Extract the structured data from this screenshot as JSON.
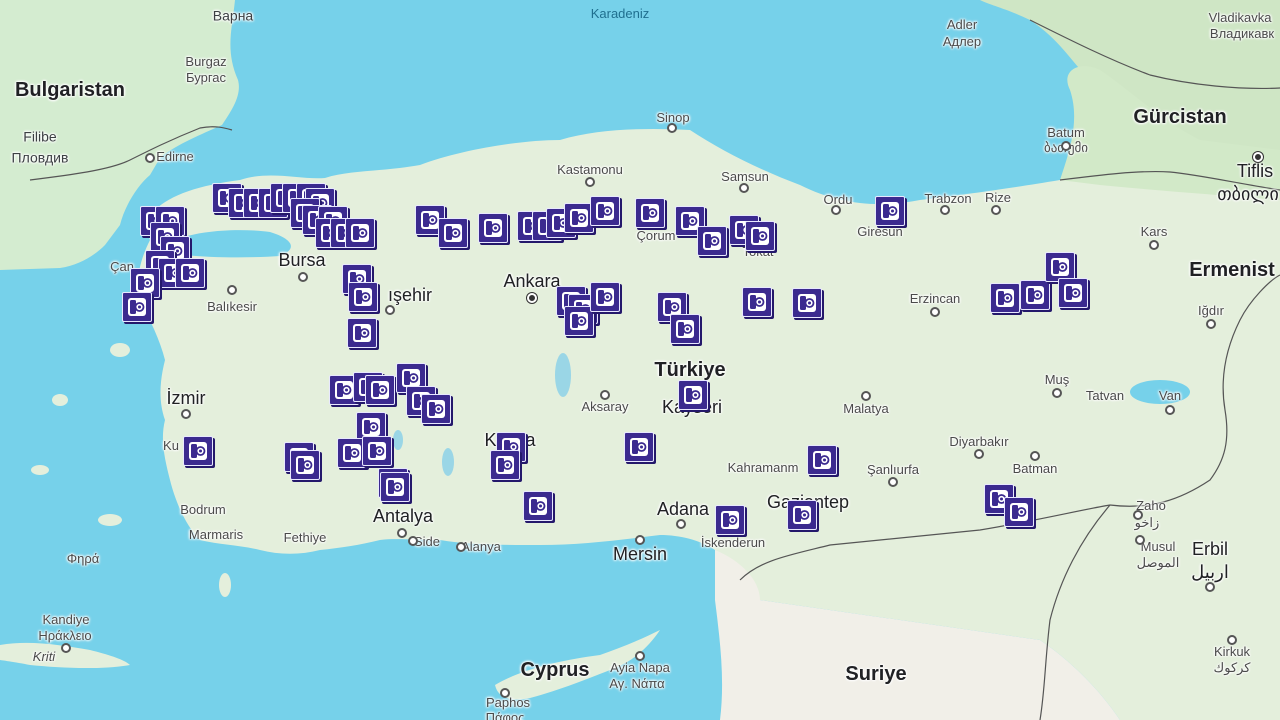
{
  "map": {
    "marker_icon": "speed-camera-icon",
    "marker_color": "#3b2a8f",
    "labels": [
      {
        "key": "karadeniz",
        "text": "Karadeniz",
        "cls": "sea"
      },
      {
        "key": "varna",
        "text": "Варна",
        "cls": "city"
      },
      {
        "key": "burgaz",
        "text": "Burgaz",
        "cls": "small"
      },
      {
        "key": "burgas_cyr",
        "text": "Бургас",
        "cls": "small"
      },
      {
        "key": "bulgaristan",
        "text": "Bulgaristan",
        "cls": "country"
      },
      {
        "key": "filibe",
        "text": "Filibe",
        "cls": "city"
      },
      {
        "key": "plovdiv",
        "text": "Пловдив",
        "cls": "city"
      },
      {
        "key": "edirne",
        "text": "Edirne",
        "cls": "small"
      },
      {
        "key": "canakkale",
        "text": "Çan",
        "cls": "small"
      },
      {
        "key": "bursa",
        "text": "Bursa",
        "cls": "city-big"
      },
      {
        "key": "balikesir",
        "text": "Balıkesir",
        "cls": "small"
      },
      {
        "key": "eskisehir",
        "text": "ışehir",
        "cls": "city-big"
      },
      {
        "key": "izmir",
        "text": "İzmir",
        "cls": "city-big"
      },
      {
        "key": "kusadasi",
        "text": "Ku",
        "cls": "small"
      },
      {
        "key": "bodrum",
        "text": "Bodrum",
        "cls": "small"
      },
      {
        "key": "marmaris",
        "text": "Marmaris",
        "cls": "small"
      },
      {
        "key": "fethiye",
        "text": "Fethiye",
        "cls": "small"
      },
      {
        "key": "antalya",
        "text": "Antalya",
        "cls": "city-big"
      },
      {
        "key": "side",
        "text": "Side",
        "cls": "small"
      },
      {
        "key": "alanya",
        "text": "Alanya",
        "cls": "small"
      },
      {
        "key": "kastamonu",
        "text": "Kastamonu",
        "cls": "small"
      },
      {
        "key": "sinop",
        "text": "Sinop",
        "cls": "small"
      },
      {
        "key": "samsun",
        "text": "Samsun",
        "cls": "small"
      },
      {
        "key": "ordu",
        "text": "Ordu",
        "cls": "small"
      },
      {
        "key": "giresun",
        "text": "Giresun",
        "cls": "small"
      },
      {
        "key": "trabzon",
        "text": "Trabzon",
        "cls": "small"
      },
      {
        "key": "rize",
        "text": "Rize",
        "cls": "small"
      },
      {
        "key": "ankara",
        "text": "Ankara",
        "cls": "city-big"
      },
      {
        "key": "corum",
        "text": "Çorum",
        "cls": "small"
      },
      {
        "key": "tokat",
        "text": "Tokat",
        "cls": "small"
      },
      {
        "key": "turkiye",
        "text": "Türkiye",
        "cls": "country"
      },
      {
        "key": "aksaray",
        "text": "Aksaray",
        "cls": "small"
      },
      {
        "key": "kayseri",
        "text": "Kayseri",
        "cls": "city-big"
      },
      {
        "key": "konya",
        "text": "Konya",
        "cls": "city-big"
      },
      {
        "key": "adana",
        "text": "Adana",
        "cls": "city-big"
      },
      {
        "key": "mersin",
        "text": "Mersin",
        "cls": "city-big"
      },
      {
        "key": "iskenderun",
        "text": "İskenderun",
        "cls": "small"
      },
      {
        "key": "kahramanmaras",
        "text": "Kahramanm",
        "cls": "small"
      },
      {
        "key": "gaziantep",
        "text": "Gaziantep",
        "cls": "city-big"
      },
      {
        "key": "sanliurfa",
        "text": "Şanlıurfa",
        "cls": "small"
      },
      {
        "key": "malatya",
        "text": "Malatya",
        "cls": "small"
      },
      {
        "key": "diyarbakir",
        "text": "Diyarbakır",
        "cls": "small"
      },
      {
        "key": "batman",
        "text": "Batman",
        "cls": "small"
      },
      {
        "key": "erzincan",
        "text": "Erzincan",
        "cls": "small"
      },
      {
        "key": "mus",
        "text": "Muş",
        "cls": "small"
      },
      {
        "key": "tatvan",
        "text": "Tatvan",
        "cls": "small"
      },
      {
        "key": "van",
        "text": "Van",
        "cls": "small"
      },
      {
        "key": "igdir",
        "text": "Iğdır",
        "cls": "small"
      },
      {
        "key": "kars",
        "text": "Kars",
        "cls": "small"
      },
      {
        "key": "batum",
        "text": "Batum",
        "cls": "small"
      },
      {
        "key": "batumi_geo",
        "text": "ბათუმი",
        "cls": "small"
      },
      {
        "key": "gurcistan",
        "text": "Gürcistan",
        "cls": "country"
      },
      {
        "key": "tiflis",
        "text": "Tiflis",
        "cls": "city-big"
      },
      {
        "key": "tbilisi_geo",
        "text": "თბილი",
        "cls": "city-big"
      },
      {
        "key": "adler",
        "text": "Adler",
        "cls": "small"
      },
      {
        "key": "adler_cyr",
        "text": "Адлер",
        "cls": "small"
      },
      {
        "key": "vladikavkaz",
        "text": "Vladikavka",
        "cls": "small"
      },
      {
        "key": "vladikavkaz_cyr",
        "text": "Владикавк",
        "cls": "small"
      },
      {
        "key": "ermenistan",
        "text": "Ermenist",
        "cls": "country"
      },
      {
        "key": "zaho",
        "text": "Zaho",
        "cls": "small"
      },
      {
        "key": "zaho_ar",
        "text": "زاخو",
        "cls": "small"
      },
      {
        "key": "erbil",
        "text": "Erbil",
        "cls": "city-big"
      },
      {
        "key": "erbil_ar",
        "text": "اربيل",
        "cls": "city-big"
      },
      {
        "key": "musul",
        "text": "Musul",
        "cls": "small"
      },
      {
        "key": "musul_ar",
        "text": "الموصل",
        "cls": "small"
      },
      {
        "key": "kirkuk",
        "text": "Kirkuk",
        "cls": "small"
      },
      {
        "key": "kirkuk_ar",
        "text": "كركوك",
        "cls": "small"
      },
      {
        "key": "suriye",
        "text": "Suriye",
        "cls": "country"
      },
      {
        "key": "cyprus",
        "text": "Cyprus",
        "cls": "country"
      },
      {
        "key": "ayianapa",
        "text": "Ayia Napa",
        "cls": "small"
      },
      {
        "key": "ayianapa_gr",
        "text": "Αγ. Νάπα",
        "cls": "small"
      },
      {
        "key": "paphos",
        "text": "Paphos",
        "cls": "small"
      },
      {
        "key": "paphos_gr",
        "text": "Πάφος",
        "cls": "small"
      },
      {
        "key": "fira",
        "text": "Φηρά",
        "cls": "small"
      },
      {
        "key": "kandiye",
        "text": "Kandiye",
        "cls": "small"
      },
      {
        "key": "heraklion_gr",
        "text": "Ηράκλειο",
        "cls": "small"
      },
      {
        "key": "kriti",
        "text": "Kriti",
        "cls": "small italic"
      }
    ]
  }
}
